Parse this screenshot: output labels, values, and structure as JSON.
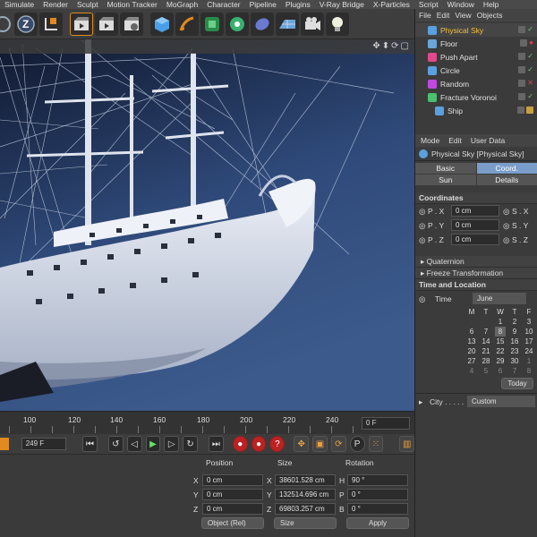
{
  "menu": [
    "Simulate",
    "Render",
    "Sculpt",
    "Motion Tracker",
    "MoGraph",
    "Character",
    "Pipeline",
    "Plugins",
    "V-Ray Bridge",
    "X-Particles",
    "Script",
    "Window",
    "Help"
  ],
  "objects_menu": [
    "File",
    "Edit",
    "View",
    "Objects"
  ],
  "objects": [
    {
      "name": "Physical Sky",
      "icon_color": "#5aa0e0",
      "selected": true,
      "status": "check"
    },
    {
      "name": "Floor",
      "icon_color": "#6aa6d8",
      "selected": false,
      "status": "dot-red"
    },
    {
      "name": "Push Apart",
      "icon_color": "#e04a8a",
      "selected": false,
      "status": "check"
    },
    {
      "name": "Circle",
      "icon_color": "#5aa0e0",
      "selected": false,
      "status": "check"
    },
    {
      "name": "Random",
      "icon_color": "#c04ae0",
      "selected": false,
      "status": "x"
    },
    {
      "name": "Fracture Voronoi",
      "icon_color": "#4ac070",
      "selected": false,
      "status": "check"
    },
    {
      "name": "Ship",
      "icon_color": "#5aa0e0",
      "selected": false,
      "status": "none"
    }
  ],
  "attr_menu": [
    "Mode",
    "Edit",
    "User Data"
  ],
  "attr_title": "Physical Sky [Physical Sky]",
  "tabs": [
    "Basic",
    "Coord.",
    "Sun",
    "Details"
  ],
  "coordinates": {
    "heading": "Coordinates",
    "px_label": "P . X",
    "px": "0 cm",
    "py_label": "P . Y",
    "py": "0 cm",
    "pz_label": "P . Z",
    "pz": "0 cm",
    "sx_label": "S . X",
    "sy_label": "S . Y",
    "sz_label": "S . Z"
  },
  "quaternion": "Quaternion",
  "freeze": "Freeze Transformation",
  "time_location": {
    "heading": "Time and Location",
    "time_label": "Time",
    "month": "June",
    "day_headers": [
      "M",
      "T",
      "W",
      "T",
      "F"
    ],
    "weeks": [
      [
        "",
        "",
        "",
        "",
        ""
      ],
      [
        "",
        "",
        "1",
        "2",
        "3"
      ],
      [
        "6",
        "7",
        "8",
        "9",
        "10"
      ],
      [
        "13",
        "14",
        "15",
        "16",
        "17"
      ],
      [
        "20",
        "21",
        "22",
        "23",
        "24"
      ],
      [
        "27",
        "28",
        "29",
        "30",
        "1"
      ],
      [
        "4",
        "5",
        "6",
        "7",
        "8"
      ]
    ],
    "selected_day": "8",
    "today": "Today",
    "city_label": "City . . . . .",
    "city_value": "Custom"
  },
  "timeline": {
    "ticks": [
      "100",
      "120",
      "140",
      "160",
      "180",
      "200",
      "220",
      "240"
    ],
    "frame": "0 F",
    "end_frame": "249 F"
  },
  "coord_manager": {
    "position_header": "Position",
    "size_header": "Size",
    "rotation_header": "Rotation",
    "x_label": "X",
    "y_label": "Y",
    "z_label": "Z",
    "px": "0 cm",
    "py": "0 cm",
    "pz": "0 cm",
    "sx": "38601.528 cm",
    "sy": "132514.696 cm",
    "sz": "69803.257 cm",
    "h_label": "H",
    "p_label": "P",
    "b_label": "B",
    "rh": "90 °",
    "rp": "0 °",
    "rb": "0 °",
    "mode": "Object (Rel)",
    "size_mode": "Size",
    "apply": "Apply"
  }
}
